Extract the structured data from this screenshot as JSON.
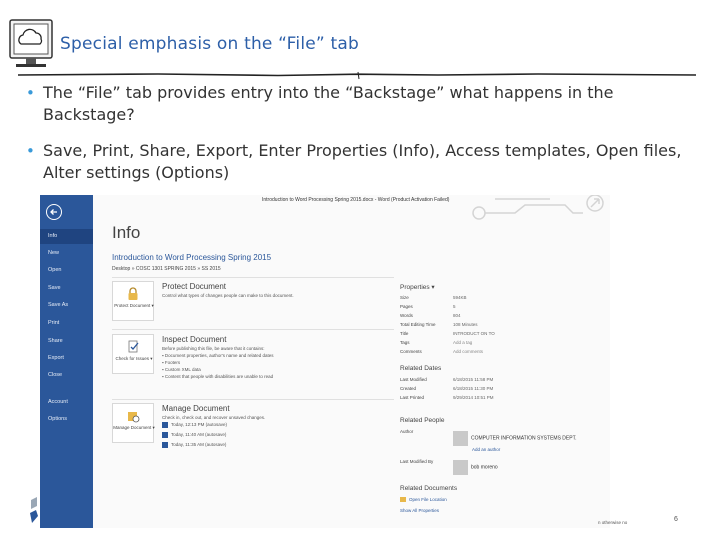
{
  "slide": {
    "title": "Special emphasis on the “File” tab",
    "bullets": [
      "The “File” tab provides entry into the “Backstage” what happens in the Backstage?",
      "Save, Print, Share, Export, Enter Properties (Info), Access templates, Open files, Alter settings (Options)"
    ],
    "page_number": "6",
    "footer_note": "n otherwise no"
  },
  "word": {
    "window_title": "Introduction to Word Processing Spring 2015.docx - Word (Product Activation Failed)",
    "sidebar": [
      {
        "label": "Info",
        "active": true
      },
      {
        "label": "New"
      },
      {
        "label": "Open"
      },
      {
        "label": "Save"
      },
      {
        "label": "Save As"
      },
      {
        "label": "Print"
      },
      {
        "label": "Share"
      },
      {
        "label": "Export"
      },
      {
        "label": "Close"
      },
      {
        "label": "Account"
      },
      {
        "label": "Options"
      }
    ],
    "heading": "Info",
    "doc_title": "Introduction to Word Processing Spring 2015",
    "doc_path": "Desktop » COSC 1301 SPRING 2015 » SS 2015",
    "protect": {
      "button": "Protect Document ▾",
      "title": "Protect Document",
      "desc": "Control what types of changes people can make to this document."
    },
    "inspect": {
      "button": "Check for Issues ▾",
      "title": "Inspect Document",
      "desc": "Before publishing this file, be aware that it contains:",
      "bullets": [
        "Document properties, author's name and related dates",
        "Footers",
        "Custom XML data",
        "Content that people with disabilities are unable to read"
      ]
    },
    "manage": {
      "button": "Manage Document ▾",
      "title": "Manage Document",
      "desc": "Check in, check out, and recover unsaved changes.",
      "versions": [
        "Today, 12:13 PM (autosave)",
        "Today, 11:40 AM (autosave)",
        "Today, 11:35 AM (autosave)"
      ]
    },
    "properties": {
      "heading": "Properties ▾",
      "rows": [
        {
          "label": "Size",
          "value": "594KB"
        },
        {
          "label": "Pages",
          "value": "5"
        },
        {
          "label": "Words",
          "value": "804"
        },
        {
          "label": "Total Editing Time",
          "value": "108 Minutes"
        },
        {
          "label": "Title",
          "value": "INTRODUCT ON TO"
        },
        {
          "label": "Tags",
          "value": "Add a tag"
        },
        {
          "label": "Comments",
          "value": "Add comments"
        }
      ]
    },
    "related_dates": {
      "heading": "Related Dates",
      "rows": [
        {
          "label": "Last Modified",
          "value": "6/18/2015 11:58 PM"
        },
        {
          "label": "Created",
          "value": "6/18/2015 11:30 PM"
        },
        {
          "label": "Last Printed",
          "value": "9/29/2014 10:51 PM"
        }
      ]
    },
    "related_people": {
      "heading": "Related People",
      "author_label": "Author",
      "author": "COMPUTER INFORMATION SYSTEMS DEPT.",
      "add_author": "Add an author",
      "modified_label": "Last Modified By",
      "modified_by": "bob moreno"
    },
    "related_docs": {
      "heading": "Related Documents",
      "open_location": "Open File Location",
      "show_all": "Show All Properties"
    }
  },
  "colors": {
    "title_blue": "#2d5fa8",
    "bullet_blue": "#3a9ad9",
    "word_blue": "#2b579a"
  }
}
